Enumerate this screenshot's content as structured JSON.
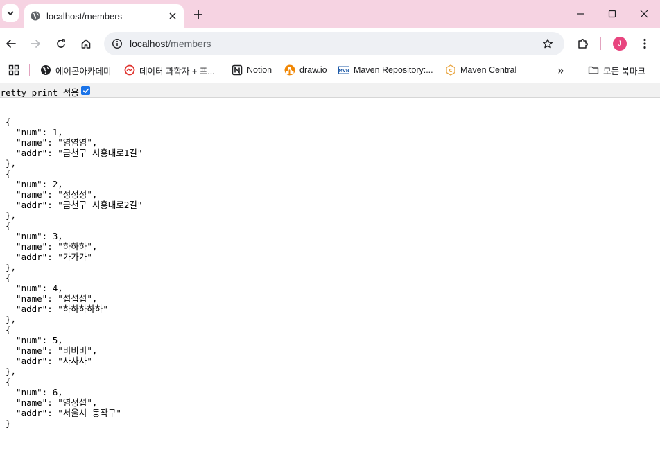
{
  "tab": {
    "title": "localhost/members"
  },
  "omnibox": {
    "host": "localhost",
    "path": "/members"
  },
  "profile": {
    "initial": "J"
  },
  "bookmarks": {
    "items": [
      {
        "label": "에이콘아카데미",
        "icon": "globe-icon"
      },
      {
        "label": "데이터 과학자 + 프...",
        "icon": "data-icon"
      },
      {
        "label": "Notion",
        "icon": "notion-icon"
      },
      {
        "label": "draw.io",
        "icon": "drawio-icon"
      },
      {
        "label": "Maven Repository:...",
        "icon": "mvn-icon"
      },
      {
        "label": "Maven Central",
        "icon": "maven-central-icon"
      }
    ],
    "all_bookmarks": "모든 북마크"
  },
  "pretty_print": {
    "label": "Pretty print 적용",
    "checked": true
  },
  "members": [
    {
      "num": 1,
      "name": "염염염",
      "addr": "금천구 시흥대로1길"
    },
    {
      "num": 2,
      "name": "정정정",
      "addr": "금천구 시흥대로2길"
    },
    {
      "num": 3,
      "name": "하하하",
      "addr": "가가가"
    },
    {
      "num": 4,
      "name": "섭섭섭",
      "addr": "하하하하하"
    },
    {
      "num": 5,
      "name": "비비비",
      "addr": "사사사"
    },
    {
      "num": 6,
      "name": "염정섭",
      "addr": "서울시 동작구"
    }
  ],
  "colors": {
    "tabstrip": "#f6d3e2",
    "accent": "#1a73e8",
    "avatar": "#e8457f"
  }
}
